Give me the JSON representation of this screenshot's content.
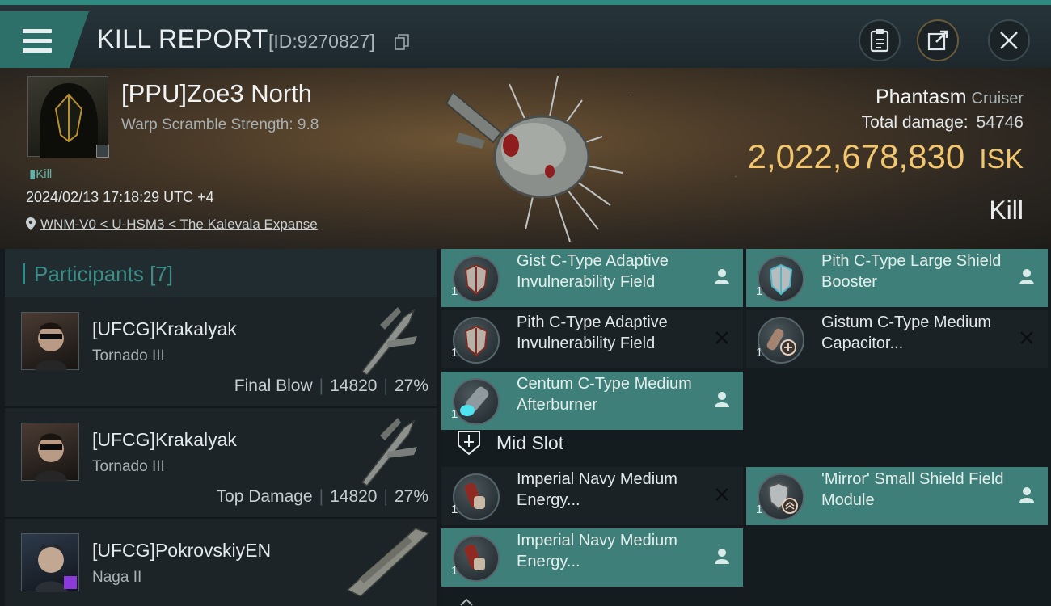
{
  "header": {
    "title": "KILL REPORT",
    "report_id": "[ID:9270827]"
  },
  "victim": {
    "name": "[PPU]Zoe3 North",
    "warp_scramble": "Warp Scramble Strength: 9.8",
    "kill_tag": "Kill",
    "datetime": "2024/02/13 17:18:29 UTC +4",
    "location": "WNM-V0 < U-HSM3 < The Kalevala Expanse"
  },
  "ship": {
    "name": "Phantasm",
    "class": "Cruiser",
    "total_damage_label": "Total damage:",
    "total_damage": "54746",
    "isk_value": "2,022,678,830",
    "isk_unit": "ISK",
    "result": "Kill"
  },
  "participants": {
    "header": "Participants [7]",
    "rows": [
      {
        "name": "[UFCG]Krakalyak",
        "ship": "Tornado III",
        "role": "Final Blow",
        "damage": "14820",
        "percent": "27%"
      },
      {
        "name": "[UFCG]Krakalyak",
        "ship": "Tornado III",
        "role": "Top Damage",
        "damage": "14820",
        "percent": "27%"
      },
      {
        "name": "[UFCG]PokrovskiyEN",
        "ship": "Naga II",
        "role": "",
        "damage": "",
        "percent": ""
      }
    ]
  },
  "modules": {
    "mid_slot_label": "Mid Slot",
    "items": [
      {
        "qty": "1",
        "name": "Gist C-Type Adaptive Invulnerability Field",
        "state": "fitted"
      },
      {
        "qty": "1",
        "name": "Pith C-Type Large Shield Booster",
        "state": "fitted"
      },
      {
        "qty": "1",
        "name": "Pith C-Type Adaptive Invulnerability Field",
        "state": "dropped"
      },
      {
        "qty": "1",
        "name": "Gistum C-Type Medium Capacitor...",
        "state": "dropped"
      },
      {
        "qty": "1",
        "name": "Centum C-Type Medium Afterburner",
        "state": "fitted"
      },
      {
        "qty": "1",
        "name": "Imperial Navy Medium Energy...",
        "state": "dropped"
      },
      {
        "qty": "1",
        "name": "'Mirror' Small Shield Field Module",
        "state": "fitted"
      },
      {
        "qty": "1",
        "name": "Imperial Navy Medium Energy...",
        "state": "fitted"
      }
    ]
  },
  "icons": {
    "menu": "menu-icon",
    "copy": "copy-icon",
    "clipboard": "clipboard-icon",
    "share": "share-icon",
    "close": "close-icon",
    "location": "location-pin-icon",
    "fitted": "person-icon",
    "dropped": "x-icon",
    "mid_slot": "mid-slot-icon"
  },
  "colors": {
    "accent": "#3f7f7a",
    "isk": "#f1c66e",
    "teal_text": "#3a8e86"
  }
}
